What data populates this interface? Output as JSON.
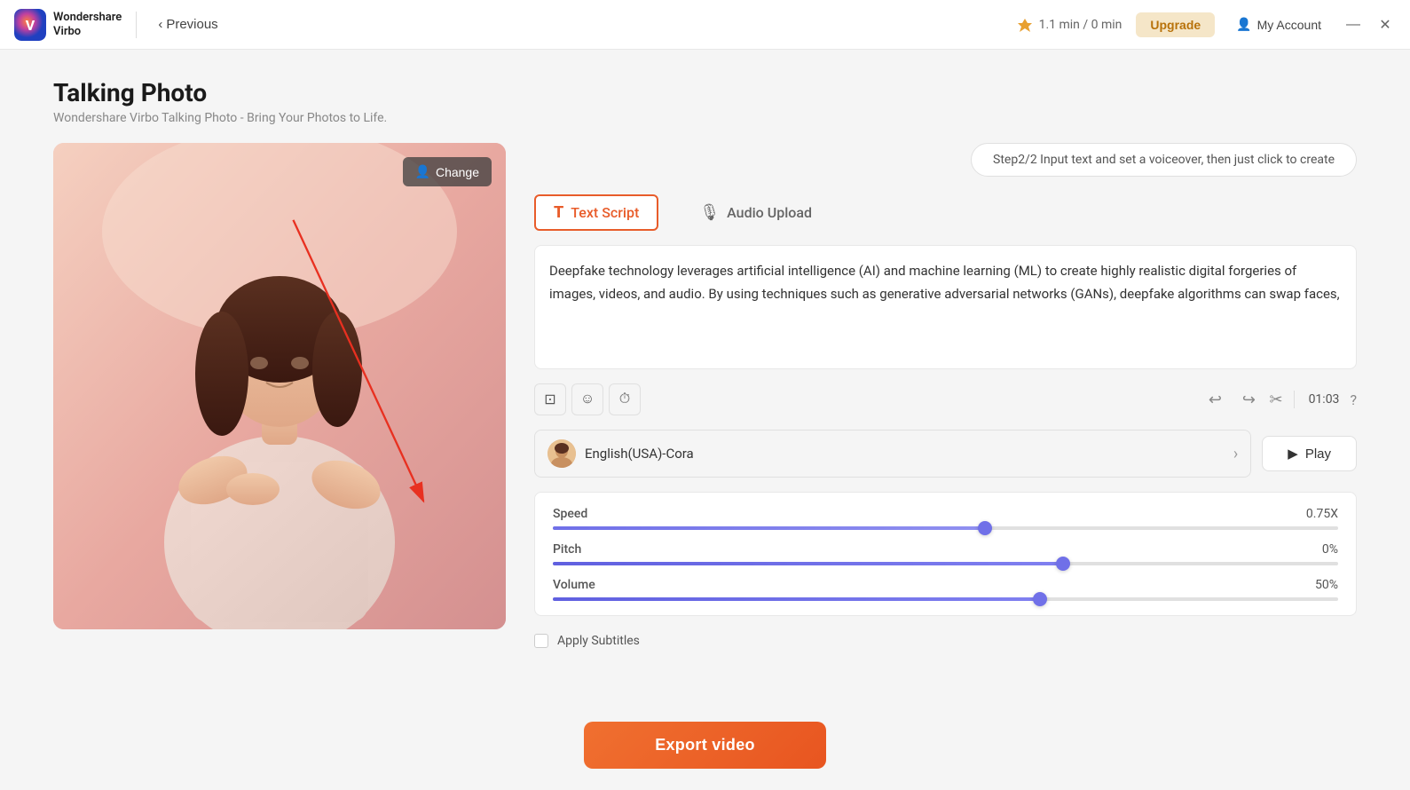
{
  "app": {
    "name": "Wondershare",
    "name2": "Virbo",
    "previous_label": "Previous"
  },
  "header": {
    "usage": "1.1 min / 0 min",
    "upgrade_label": "Upgrade",
    "account_label": "My Account"
  },
  "page": {
    "title": "Talking Photo",
    "subtitle": "Wondershare Virbo Talking Photo - Bring Your Photos to Life.",
    "step_indicator": "Step2/2 Input text and set a voiceover, then just click to create"
  },
  "change_button": "Change",
  "tabs": [
    {
      "id": "text-script",
      "label": "Text Script",
      "icon": "T",
      "active": true
    },
    {
      "id": "audio-upload",
      "label": "Audio Upload",
      "icon": "🎙",
      "active": false
    }
  ],
  "script_text": "Deepfake technology leverages artificial intelligence (AI) and machine learning (ML) to create highly realistic digital forgeries of images, videos, and audio. By using techniques such as generative adversarial networks (GANs), deepfake algorithms can swap faces,",
  "toolbar": {
    "btn1": "⊡",
    "btn2": "☺",
    "btn3": "⏱",
    "undo": "↩",
    "redo": "↪",
    "clear": "✕",
    "time": "01:03",
    "help": "?"
  },
  "voice": {
    "name": "English(USA)-Cora",
    "play_label": "Play"
  },
  "sliders": {
    "speed": {
      "label": "Speed",
      "value": "0.75X",
      "percent": 55
    },
    "pitch": {
      "label": "Pitch",
      "value": "0%",
      "percent": 65
    },
    "volume": {
      "label": "Volume",
      "value": "50%",
      "percent": 62
    }
  },
  "subtitles": {
    "label": "Apply Subtitles",
    "checked": false
  },
  "export": {
    "label": "Export video"
  }
}
